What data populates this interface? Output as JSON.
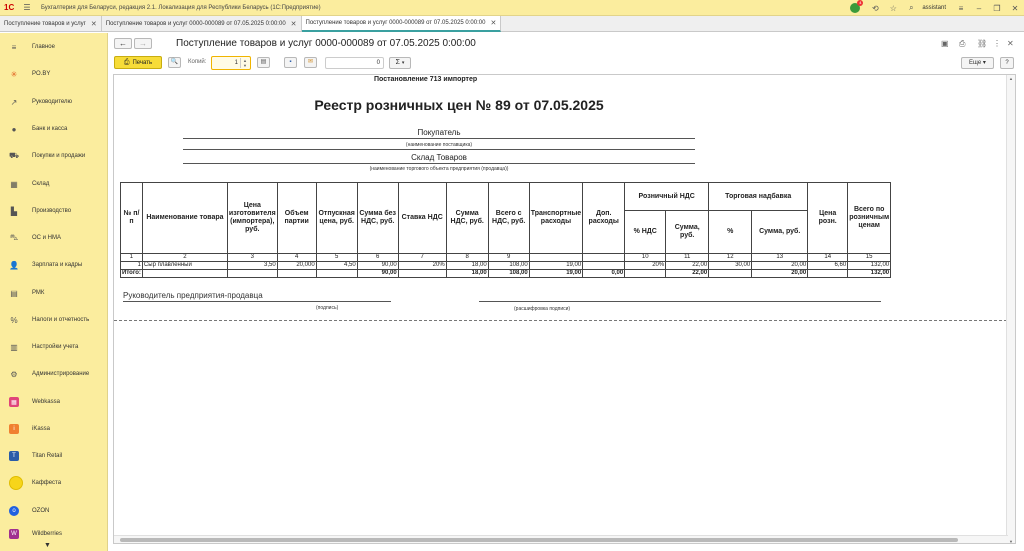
{
  "titlebar": {
    "title": "Бухгалтерия для Беларуси, редакция 2.1. Локализация для Республики Беларусь   (1С:Предприятие)",
    "user": "assistant",
    "notif_count": "4"
  },
  "tabs": [
    {
      "label": "Поступление товаров и услуг"
    },
    {
      "label": "Поступление товаров и услуг 0000-000089 от 07.05.2025 0:00:00"
    },
    {
      "label": "Поступление товаров и услуг 0000-000089 от 07.05.2025 0:00:00"
    }
  ],
  "sidebar": {
    "items": [
      {
        "label": "Главное",
        "icon": "menu-icon"
      },
      {
        "label": "PO.BY",
        "icon": "asterisk-icon"
      },
      {
        "label": "Руководителю",
        "icon": "trend-icon"
      },
      {
        "label": "Банк и касса",
        "icon": "coin-icon"
      },
      {
        "label": "Покупки и продажи",
        "icon": "cart-icon"
      },
      {
        "label": "Склад",
        "icon": "warehouse-icon"
      },
      {
        "label": "Производство",
        "icon": "factory-icon"
      },
      {
        "label": "ОС и НМА",
        "icon": "car-icon"
      },
      {
        "label": "Зарплата и кадры",
        "icon": "person-icon"
      },
      {
        "label": "РМК",
        "icon": "register-icon"
      },
      {
        "label": "Налоги и отчетность",
        "icon": "tax-icon"
      },
      {
        "label": "Настройки учета",
        "icon": "book-icon"
      },
      {
        "label": "Администрирование",
        "icon": "gear-icon"
      },
      {
        "label": "Webkassa",
        "icon": "webkassa-icon"
      },
      {
        "label": "iKassa",
        "icon": "ikassa-icon"
      },
      {
        "label": "Titan Retail",
        "icon": "titan-icon"
      },
      {
        "label": "Каффеста",
        "icon": "kaffesta-icon"
      },
      {
        "label": "OZON",
        "icon": "ozon-icon"
      },
      {
        "label": "Wildberries",
        "icon": "wildberries-icon"
      }
    ]
  },
  "doc": {
    "title": "Поступление товаров и услуг 0000-000089 от 07.05.2025 0:00:00"
  },
  "toolbar": {
    "print_label": "Печать",
    "copies_label": "Копий:",
    "copies_value": "1",
    "sum_value": "0",
    "more_label": "Еще",
    "help_label": "?",
    "sum_symbol": "Σ"
  },
  "report": {
    "header": "Постановление 713 импортер",
    "title": "Реестр розничных цен № 89 от 07.05.2025",
    "buyer": "Покупатель",
    "buyer_caption": "(наименование поставщика)",
    "store": "Склад Товаров",
    "store_caption": "(наименование торгового объекта предприятия (продавца))",
    "col_headers": [
      "№ п/п",
      "Наименование товара",
      "Цена изготовителя (импортера), руб.",
      "Объем партии",
      "Отпускная цена, руб.",
      "Сумма без НДС, руб.",
      "Ставка НДС",
      "Сумма НДС, руб.",
      "Всего с НДС, руб.",
      "Транспортные расходы",
      "Доп. расходы",
      "Розничный НДС",
      "Торговая надбавка",
      "Цена розн.",
      "Всего по розничным ценам"
    ],
    "sub_headers": [
      "% НДС",
      "Сумма, руб.",
      "%",
      "Сумма, руб."
    ],
    "col_numbers": [
      "1",
      "2",
      "3",
      "4",
      "5",
      "6",
      "7",
      "8",
      "9",
      "",
      "",
      "10",
      "11",
      "12",
      "13",
      "14",
      "15"
    ],
    "rows": [
      [
        "1",
        "Сыр плавленный",
        "3,50",
        "20,000",
        "4,50",
        "90,00",
        "20%",
        "18,00",
        "108,00",
        "19,00",
        "",
        "20%",
        "22,00",
        "30,00",
        "20,00",
        "6,60",
        "132,00"
      ]
    ],
    "total": [
      "Итого:",
      "",
      "",
      "",
      "",
      "90,00",
      "",
      "18,00",
      "108,00",
      "19,00",
      "0,00",
      "",
      "22,00",
      "",
      "20,00",
      "",
      "132,00"
    ],
    "sign_label": "Руководитель предприятия-продавца",
    "sign_caption": "(подпись)",
    "sign_decode": "(расшифровка подписи)"
  }
}
